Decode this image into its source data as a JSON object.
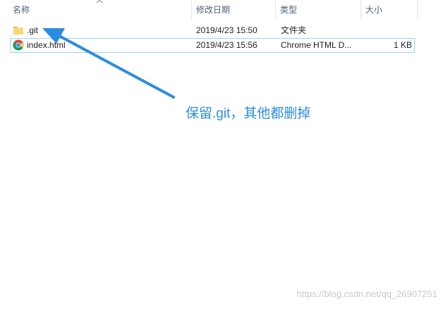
{
  "columns": {
    "name": "名称",
    "modified": "修改日期",
    "type": "类型",
    "size": "大小"
  },
  "files": [
    {
      "name": ".git",
      "modified": "2019/4/23 15:50",
      "type": "文件夹",
      "size": "",
      "icon": "folder-icon"
    },
    {
      "name": "index.html",
      "modified": "2019/4/23 15:56",
      "type": "Chrome HTML D...",
      "size": "1 KB",
      "icon": "chrome-icon"
    }
  ],
  "annotation": {
    "text": "保留.git，其他都删掉",
    "color": "#2a8de0"
  },
  "watermark": "https://blog.csdn.net/qq_26907251",
  "colors": {
    "header_text": "#4c607a",
    "selection_border": "#99d1ff",
    "folder": "#f8d775"
  }
}
